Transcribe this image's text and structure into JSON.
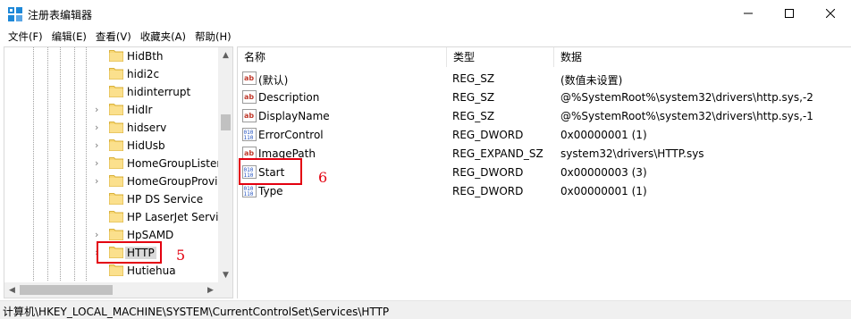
{
  "window": {
    "title": "注册表编辑器",
    "minimize_icon": "minimize-icon",
    "maximize_icon": "maximize-icon",
    "close_icon": "close-icon"
  },
  "menu": [
    {
      "label": "文件(F)"
    },
    {
      "label": "编辑(E)"
    },
    {
      "label": "查看(V)"
    },
    {
      "label": "收藏夹(A)"
    },
    {
      "label": "帮助(H)"
    }
  ],
  "tree": {
    "items": [
      {
        "label": "HidBth",
        "expandable": false
      },
      {
        "label": "hidi2c",
        "expandable": false
      },
      {
        "label": "hidinterrupt",
        "expandable": false
      },
      {
        "label": "HidIr",
        "expandable": true
      },
      {
        "label": "hidserv",
        "expandable": true
      },
      {
        "label": "HidUsb",
        "expandable": true
      },
      {
        "label": "HomeGroupListener",
        "expandable": true
      },
      {
        "label": "HomeGroupProvider",
        "expandable": true
      },
      {
        "label": "HP DS Service",
        "expandable": false
      },
      {
        "label": "HP LaserJet Service",
        "expandable": false
      },
      {
        "label": "HpSAMD",
        "expandable": true
      },
      {
        "label": "HTTP",
        "expandable": true,
        "selected": true
      },
      {
        "label": "Hutiehua",
        "expandable": false
      }
    ]
  },
  "values": {
    "headers": {
      "name": "名称",
      "type": "类型",
      "data": "数据"
    },
    "rows": [
      {
        "icon": "string-value-icon",
        "name": "(默认)",
        "type": "REG_SZ",
        "data": "(数值未设置)"
      },
      {
        "icon": "string-value-icon",
        "name": "Description",
        "type": "REG_SZ",
        "data": "@%SystemRoot%\\system32\\drivers\\http.sys,-2"
      },
      {
        "icon": "string-value-icon",
        "name": "DisplayName",
        "type": "REG_SZ",
        "data": "@%SystemRoot%\\system32\\drivers\\http.sys,-1"
      },
      {
        "icon": "binary-value-icon",
        "name": "ErrorControl",
        "type": "REG_DWORD",
        "data": "0x00000001 (1)"
      },
      {
        "icon": "string-value-icon",
        "name": "ImagePath",
        "type": "REG_EXPAND_SZ",
        "data": "system32\\drivers\\HTTP.sys"
      },
      {
        "icon": "binary-value-icon",
        "name": "Start",
        "type": "REG_DWORD",
        "data": "0x00000003 (3)"
      },
      {
        "icon": "binary-value-icon",
        "name": "Type",
        "type": "REG_DWORD",
        "data": "0x00000001 (1)"
      }
    ]
  },
  "annotations": {
    "tree_label": "5",
    "values_label": "6",
    "color": "#e3000f"
  },
  "status": {
    "path": "计算机\\HKEY_LOCAL_MACHINE\\SYSTEM\\CurrentControlSet\\Services\\HTTP"
  }
}
